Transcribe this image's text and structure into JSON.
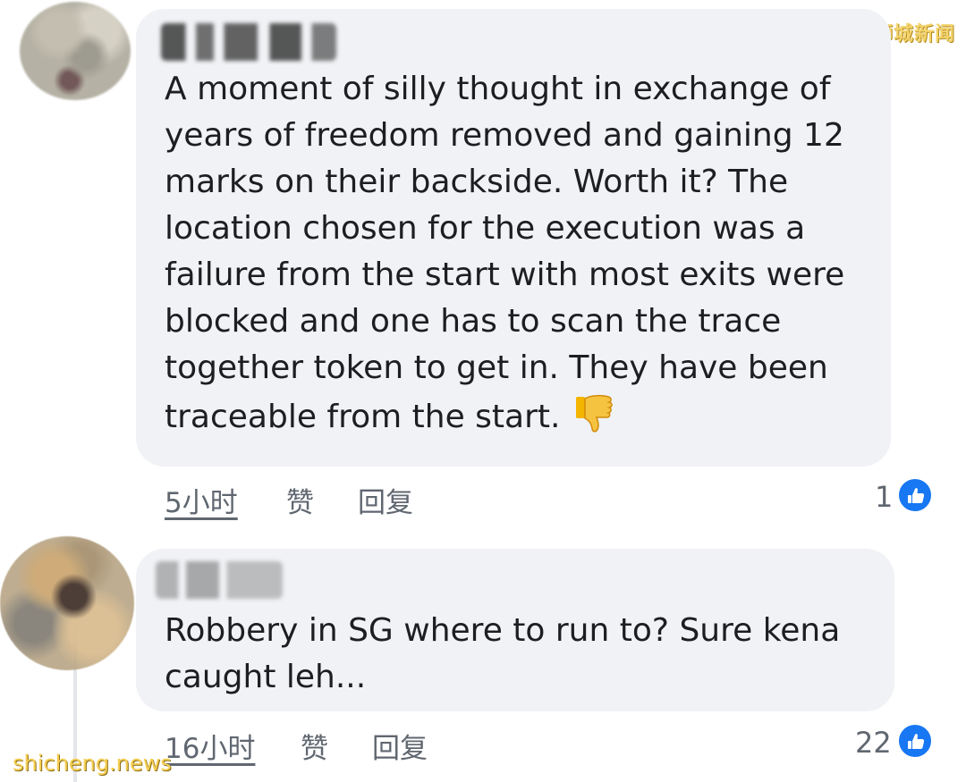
{
  "watermarks": {
    "top_right": "狮城新闻",
    "bottom_left": "shicheng.news"
  },
  "comments": [
    {
      "author": "",
      "text": "A moment of silly thought in exchange of\nyears of freedom removed and gaining 12\nmarks on their backside. Worth it? The\nlocation chosen for the execution was a\nfailure from the start with most exits were\nblocked and one has to scan the trace\ntogether token to get in. They have been\ntraceable from the start.",
      "emoji": "thumbs-down",
      "time": "5小时",
      "like_label": "赞",
      "reply_label": "回复",
      "reaction_count": "1"
    },
    {
      "author": "",
      "text": "Robbery in SG where to run to? Sure kena\ncaught leh...",
      "time": "16小时",
      "like_label": "赞",
      "reply_label": "回复",
      "reaction_count": "22"
    }
  ],
  "colors": {
    "bubble": "#f0f2f5",
    "text": "#1c1e21",
    "meta": "#606770",
    "like_blue": "#1877f2"
  }
}
